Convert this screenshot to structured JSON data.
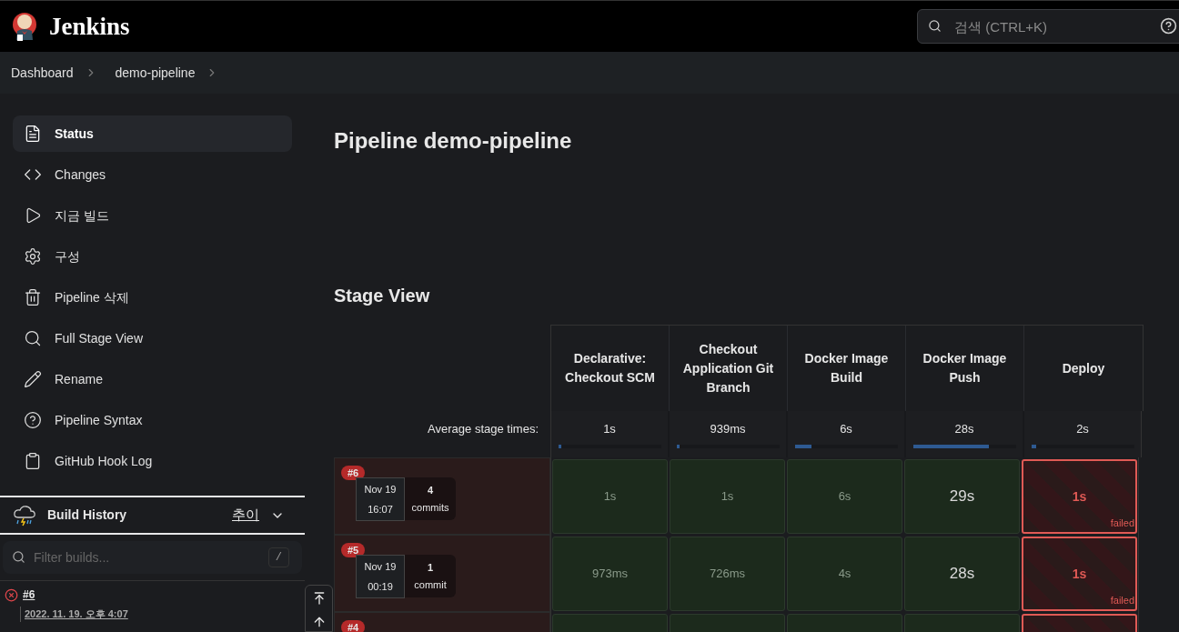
{
  "header": {
    "brand": "Jenkins",
    "search": {
      "placeholder": "검색 (CTRL+K)"
    }
  },
  "breadcrumbs": [
    "Dashboard",
    "demo-pipeline"
  ],
  "sidebar": {
    "items": [
      {
        "label": "Status",
        "selected": true
      },
      {
        "label": "Changes",
        "selected": false
      },
      {
        "label": "지금 빌드",
        "selected": false
      },
      {
        "label": "구성",
        "selected": false
      },
      {
        "label": "Pipeline 삭제",
        "selected": false
      },
      {
        "label": "Full Stage View",
        "selected": false
      },
      {
        "label": "Rename",
        "selected": false
      },
      {
        "label": "Pipeline Syntax",
        "selected": false
      },
      {
        "label": "GitHub Hook Log",
        "selected": false
      }
    ]
  },
  "build_history": {
    "title": "Build History",
    "trend_link": "추이",
    "filter": {
      "placeholder": "Filter builds...",
      "shortcut": "/"
    },
    "builds": [
      {
        "number": "#6",
        "date": "2022. 11. 19. 오후 4:07",
        "kind": "failed"
      }
    ]
  },
  "page_title": "Pipeline demo-pipeline",
  "stage_view": {
    "title": "Stage View",
    "average_label": "Average stage times:",
    "stages": [
      {
        "name": "Declarative: Checkout SCM",
        "average": "1s",
        "level": 0.03
      },
      {
        "name": "Checkout Application Git Branch",
        "average": "939ms",
        "level": 0.03
      },
      {
        "name": "Docker Image Build",
        "average": "6s",
        "level": 0.16
      },
      {
        "name": "Docker Image Push",
        "average": "28s",
        "level": 0.74
      },
      {
        "name": "Deploy",
        "average": "2s",
        "level": 0.05
      }
    ],
    "runs": [
      {
        "number": "#6",
        "date": "Nov 19",
        "time": "16:07",
        "commit_count": "4",
        "commit_label": "commits",
        "kind": "failed",
        "cells": [
          {
            "duration": "1s",
            "kind": "success",
            "highlight": false
          },
          {
            "duration": "1s",
            "kind": "success",
            "highlight": false
          },
          {
            "duration": "6s",
            "kind": "success",
            "highlight": false
          },
          {
            "duration": "29s",
            "kind": "success",
            "highlight": true
          },
          {
            "duration": "1s",
            "kind": "failed",
            "note": "failed"
          }
        ]
      },
      {
        "number": "#5",
        "date": "Nov 19",
        "time": "00:19",
        "commit_count": "1",
        "commit_label": "commit",
        "kind": "failed",
        "cells": [
          {
            "duration": "973ms",
            "kind": "success",
            "highlight": false
          },
          {
            "duration": "726ms",
            "kind": "success",
            "highlight": false
          },
          {
            "duration": "4s",
            "kind": "success",
            "highlight": false
          },
          {
            "duration": "28s",
            "kind": "success",
            "highlight": true
          },
          {
            "duration": "1s",
            "kind": "failed",
            "note": "failed"
          }
        ]
      },
      {
        "number": "#4",
        "kind": "failed",
        "cells": [
          {
            "kind": "success"
          },
          {
            "kind": "success"
          },
          {
            "kind": "success"
          },
          {
            "kind": "success"
          },
          {
            "kind": "failed"
          }
        ]
      }
    ]
  }
}
